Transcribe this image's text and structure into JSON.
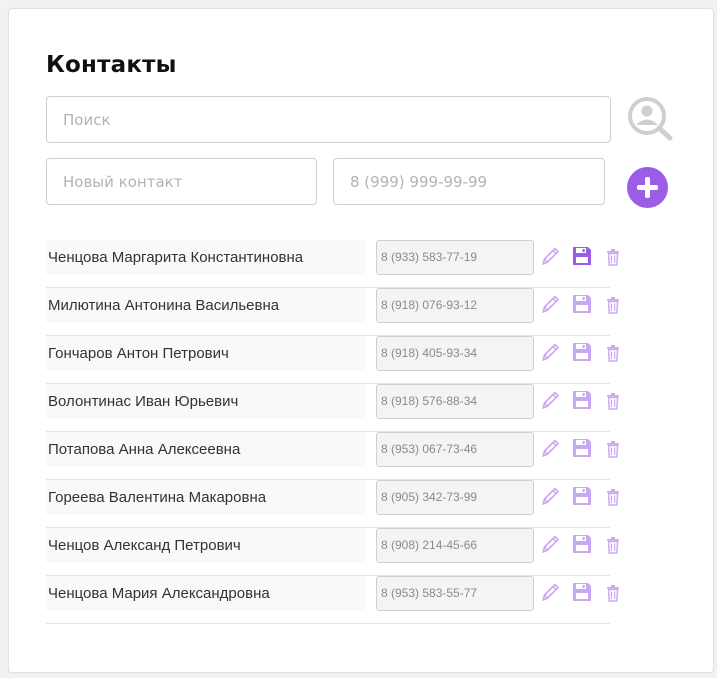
{
  "page": {
    "title": "Контакты"
  },
  "search": {
    "placeholder": "Поиск",
    "icon": "search-person-icon"
  },
  "new_contact": {
    "name_placeholder": "Новый контакт",
    "phone_placeholder": "8 (999) 999-99-99",
    "add_icon": "plus-circle-icon"
  },
  "colors": {
    "accent": "#9b5de5",
    "accent_light": "#c9a8f0",
    "search_icon": "#cfcfcf"
  },
  "contacts": [
    {
      "name": "Ченцова Маргарита Константиновна",
      "phone": "8 (933) 583-77-19"
    },
    {
      "name": "Милютина Антонина Васильевна",
      "phone": "8 (918) 076-93-12"
    },
    {
      "name": "Гончаров Антон Петрович",
      "phone": "8 (918) 405-93-34"
    },
    {
      "name": "Волонтинас Иван Юрьевич",
      "phone": "8 (918) 576-88-34"
    },
    {
      "name": "Потапова Анна Алексеевна",
      "phone": "8 (953) 067-73-46"
    },
    {
      "name": "Гореева Валентина Макаровна",
      "phone": "8 (905) 342-73-99"
    },
    {
      "name": "Ченцов Александ Петрович",
      "phone": "8 (908) 214-45-66"
    },
    {
      "name": "Ченцова Мария Александровна",
      "phone": "8 (953) 583-55-77"
    }
  ],
  "row_icons": {
    "edit": "pencil-icon",
    "save": "floppy-disk-icon",
    "delete": "trash-icon"
  }
}
